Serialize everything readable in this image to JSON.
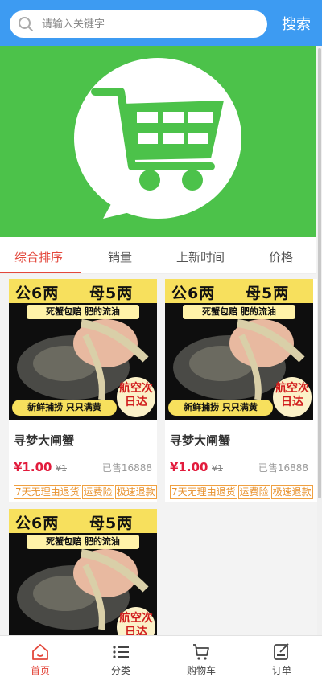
{
  "search": {
    "placeholder": "请输入关键字",
    "button_label": "搜索"
  },
  "colors": {
    "header_bg": "#3d9bf2",
    "banner_bg": "#4cc24a",
    "accent_red": "#e3473b",
    "price_red": "#e21b3c",
    "tag_orange": "#e8912c"
  },
  "sort_tabs": [
    {
      "label": "综合排序",
      "active": true
    },
    {
      "label": "销量",
      "active": false
    },
    {
      "label": "上新时间",
      "active": false
    },
    {
      "label": "价格",
      "active": false
    }
  ],
  "products": [
    {
      "name": "寻梦大闸蟹",
      "price": "¥1.00",
      "old_price": "¥1",
      "sold": "已售16888",
      "tags": [
        "7天无理由退货",
        "运费险",
        "极速退款"
      ],
      "poster": {
        "title_left": "公6两",
        "title_right": "母5两",
        "sub": "死蟹包赔 肥的流油",
        "banner": "新鲜捕捞 只只满黄",
        "seal": "航空次日达"
      }
    },
    {
      "name": "寻梦大闸蟹",
      "price": "¥1.00",
      "old_price": "¥1",
      "sold": "已售16888",
      "tags": [
        "7天无理由退货",
        "运费险",
        "极速退款"
      ],
      "poster": {
        "title_left": "公6两",
        "title_right": "母5两",
        "sub": "死蟹包赔 肥的流油",
        "banner": "新鲜捕捞 只只满黄",
        "seal": "航空次日达"
      }
    },
    {
      "name": "",
      "poster": {
        "title_left": "公6两",
        "title_right": "母5两",
        "sub": "死蟹包赔 肥的流油",
        "seal": "航空次日达"
      }
    }
  ],
  "bottom_nav": [
    {
      "label": "首页",
      "icon": "home-icon",
      "active": true
    },
    {
      "label": "分类",
      "icon": "list-icon",
      "active": false
    },
    {
      "label": "购物车",
      "icon": "cart-icon",
      "active": false
    },
    {
      "label": "订单",
      "icon": "order-icon",
      "active": false
    }
  ]
}
